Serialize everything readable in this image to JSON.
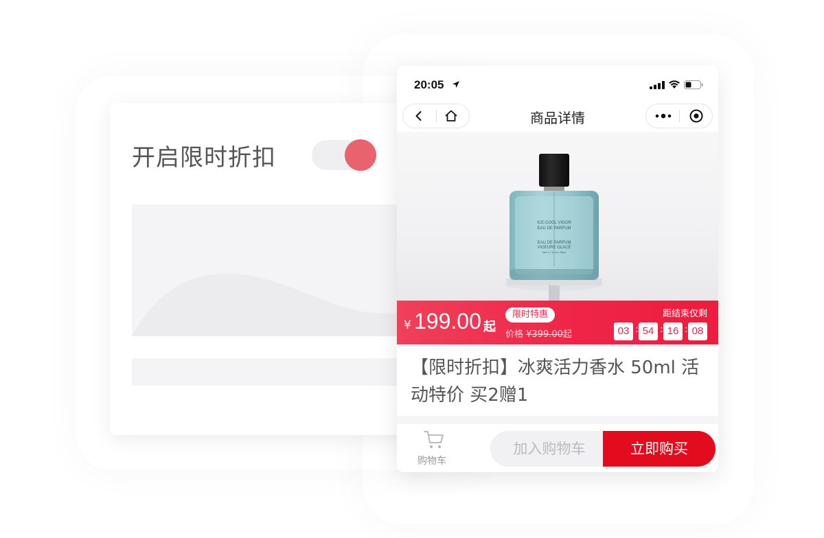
{
  "settings_card": {
    "label": "开启限时折扣",
    "toggle_on": true,
    "accent_color": "#e8636e"
  },
  "phone": {
    "status_bar": {
      "time": "20:05"
    },
    "nav": {
      "title": "商品详情"
    },
    "product_image_text": {
      "line1": "ICE-COOL VIGOR",
      "line2": "EAU DE PARFUM",
      "line3": "EAU DE PARFUM",
      "line4": "VIGEURE GLACÉ",
      "line5": "Net 1.7 fl. oz / 50ml"
    },
    "promo": {
      "currency": "¥",
      "price": "199.00",
      "price_suffix": "起",
      "tag": "限时特惠",
      "orig_label": "价格",
      "orig_price": "¥399.00",
      "orig_suffix": "起",
      "countdown_label": "距结束仅剩",
      "countdown": [
        "03",
        "54",
        "16",
        "08"
      ],
      "colors": {
        "start": "#f0405a",
        "end": "#ec1d3e"
      }
    },
    "product_title": "【限时折扣】冰爽活力香水 50ml 活动特价 买2赠1",
    "bottom": {
      "cart_label": "购物车",
      "add_to_cart": "加入购物车",
      "buy_now": "立即购买",
      "buy_color": "#e30c1e"
    }
  }
}
